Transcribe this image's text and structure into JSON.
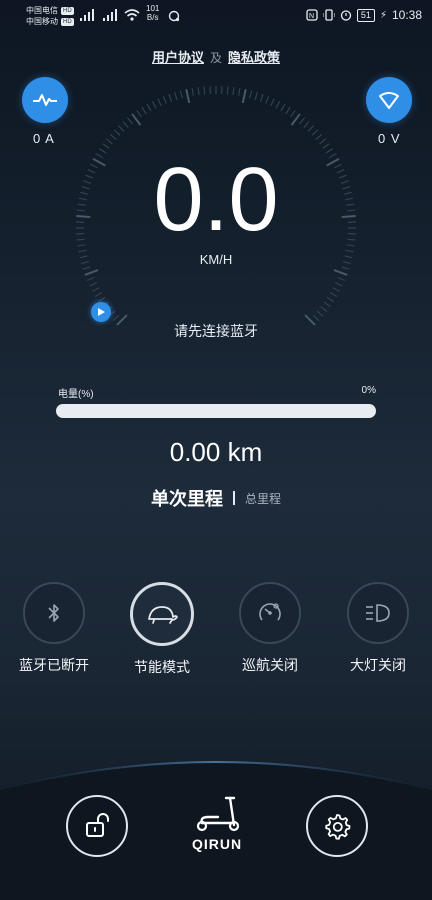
{
  "status_bar": {
    "carrier1": "中国电信",
    "carrier1_badge": "HD",
    "carrier2": "中国移动",
    "carrier2_badge": "HD",
    "net_speed_value": "101",
    "net_speed_unit": "B/s",
    "battery": "51",
    "time": "10:38"
  },
  "links": {
    "user_agreement": "用户协议",
    "and": "及",
    "privacy_policy": "隐私政策"
  },
  "current": {
    "value": "0 A",
    "icon": "pulse-icon"
  },
  "voltage": {
    "value": "0 V",
    "icon": "drop-down-icon"
  },
  "speedometer": {
    "speed": "0.0",
    "unit": "KM/H",
    "hint": "请先连接蓝牙"
  },
  "battery_level": {
    "label": "电量(%)",
    "percent_text": "0%",
    "value": 0
  },
  "mileage": {
    "value": "0.00 km",
    "tab_single": "单次里程",
    "tab_total": "总里程"
  },
  "functions": [
    {
      "label": "蓝牙已断开",
      "icon": "bluetooth-icon",
      "active": false
    },
    {
      "label": "节能模式",
      "icon": "turtle-icon",
      "active": true
    },
    {
      "label": "巡航关闭",
      "icon": "cruise-icon",
      "active": false
    },
    {
      "label": "大灯关闭",
      "icon": "headlight-icon",
      "active": false
    }
  ],
  "bottom_nav": {
    "lock_icon": "unlock-icon",
    "logo": "QIRUN",
    "settings_icon": "gear-icon"
  },
  "colors": {
    "accent": "#2f8fe6",
    "background": "#172331",
    "progress_track": "#e9edf1"
  }
}
